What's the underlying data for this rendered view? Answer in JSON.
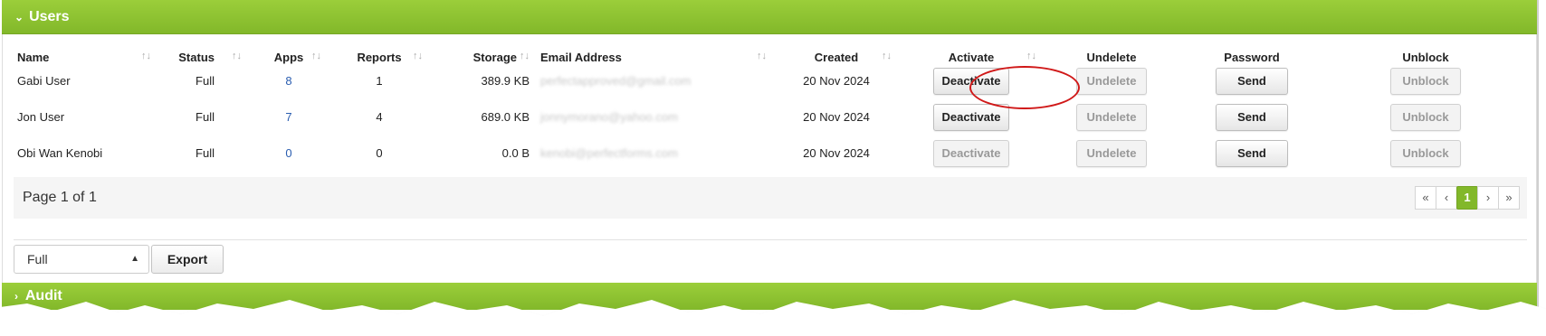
{
  "panel": {
    "title": "Users",
    "chevron": "chevron-down-icon"
  },
  "columns": [
    "Name",
    "Status",
    "Apps",
    "Reports",
    "Storage",
    "Email Address",
    "Created",
    "Activate",
    "Undelete",
    "Password",
    "Unblock"
  ],
  "sort_glyph": "↑↓",
  "rows": [
    {
      "name": "Gabi User",
      "status": "Full",
      "apps": "8",
      "reports": "1",
      "storage": "389.9 KB",
      "email": "perfectapproved@gmail.com",
      "created": "20 Nov 2024",
      "activate": "Deactivate",
      "undelete": "Undelete",
      "password": "Send",
      "unblock": "Unblock"
    },
    {
      "name": "Jon User",
      "status": "Full",
      "apps": "7",
      "reports": "4",
      "storage": "689.0 KB",
      "email": "jonnymorano@yahoo.com",
      "created": "20 Nov 2024",
      "activate": "Deactivate",
      "undelete": "Undelete",
      "password": "Send",
      "unblock": "Unblock"
    },
    {
      "name": "Obi Wan Kenobi",
      "status": "Full",
      "apps": "0",
      "reports": "0",
      "storage": "0.0 B",
      "email": "kenobi@perfectforms.com",
      "created": "20 Nov 2024",
      "activate": "Deactivate",
      "undelete": "Undelete",
      "password": "Send",
      "unblock": "Unblock"
    }
  ],
  "pagination": {
    "label": "Page 1 of 1",
    "first": "«",
    "prev": "‹",
    "current": "1",
    "next": "›",
    "last": "»"
  },
  "filter": {
    "selected": "Full"
  },
  "export_label": "Export",
  "audit": {
    "title": "Audit",
    "chevron": "chevron-right-icon"
  },
  "colors": {
    "header_green": "#8cc233",
    "highlight_circle": "#d01818",
    "link_blue": "#2a5db0"
  }
}
